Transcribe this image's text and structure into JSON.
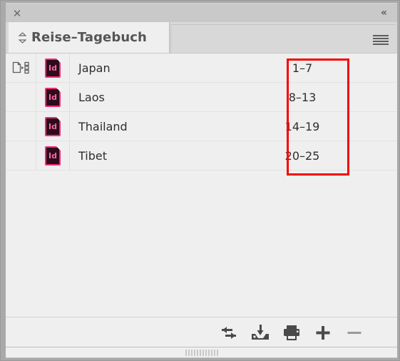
{
  "window": {
    "close_label": "✕",
    "collapse_label": "«"
  },
  "tab": {
    "handle_icon": "diamond-drag-handle-icon",
    "title": "Reise–Tagebuch",
    "menu_icon": "panel-menu-icon"
  },
  "list": {
    "columns": [
      "style-source",
      "document-icon",
      "document-name",
      "page-range"
    ],
    "rows": [
      {
        "style_source": true,
        "icon": "Id",
        "name": "Japan",
        "pages": "1–7"
      },
      {
        "style_source": false,
        "icon": "Id",
        "name": "Laos",
        "pages": "8–13"
      },
      {
        "style_source": false,
        "icon": "Id",
        "name": "Thailand",
        "pages": "14–19"
      },
      {
        "style_source": false,
        "icon": "Id",
        "name": "Tibet",
        "pages": "20–25"
      }
    ]
  },
  "annotation": {
    "highlight_color": "#f60000",
    "target": "page-range-column"
  },
  "toolbar": {
    "buttons": [
      {
        "name": "sync-book-button",
        "icon": "sync-arrows-icon"
      },
      {
        "name": "save-book-button",
        "icon": "save-tray-icon"
      },
      {
        "name": "print-book-button",
        "icon": "printer-icon"
      },
      {
        "name": "add-document-button",
        "icon": "plus-icon"
      },
      {
        "name": "remove-document-button",
        "icon": "minus-icon"
      }
    ]
  },
  "colors": {
    "panel_background": "#efefef",
    "tab_bar": "#d8d8d8",
    "frame": "#a9a9a9",
    "indesign_magenta": "#f62a7b",
    "indesign_dark": "#2e0b1b",
    "text": "#2e2e2e"
  }
}
